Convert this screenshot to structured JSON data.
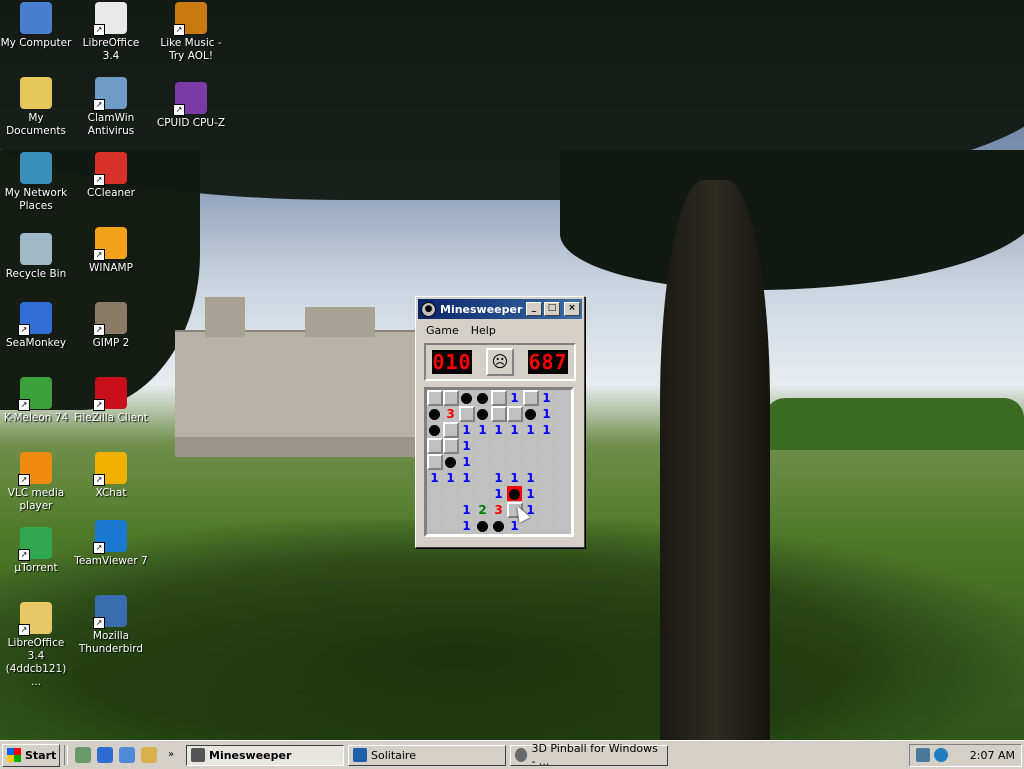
{
  "desktop_icons": [
    {
      "label": "My Computer",
      "icon": "computer-icon",
      "color": "#4a7fd0"
    },
    {
      "label": "My Documents",
      "icon": "documents-folder-icon",
      "color": "#e7c65a"
    },
    {
      "label": "My Network Places",
      "icon": "network-places-icon",
      "color": "#3a8fb8"
    },
    {
      "label": "Recycle Bin",
      "icon": "recycle-bin-icon",
      "color": "#9fb8c8"
    },
    {
      "label": "SeaMonkey",
      "icon": "seamonkey-icon",
      "color": "#2f6fd6"
    },
    {
      "label": "K-Meleon 74",
      "icon": "k-meleon-icon",
      "color": "#3aa13a"
    },
    {
      "label": "VLC media player",
      "icon": "vlc-icon",
      "color": "#f08a10"
    },
    {
      "label": "µTorrent",
      "icon": "utorrent-icon",
      "color": "#2fa84f"
    },
    {
      "label": "LibreOffice 3.4 (4ddcb121) ...",
      "icon": "folder-icon",
      "color": "#e8c864"
    },
    {
      "label": "LibreOffice 3.4",
      "icon": "libreoffice-icon",
      "color": "#e9e9e9"
    },
    {
      "label": "ClamWin Antivirus",
      "icon": "clamwin-icon",
      "color": "#6f9bc7"
    },
    {
      "label": "CCleaner",
      "icon": "ccleaner-icon",
      "color": "#d9302a"
    },
    {
      "label": "WINAMP",
      "icon": "winamp-icon",
      "color": "#f2a21a"
    },
    {
      "label": "GIMP 2",
      "icon": "gimp-icon",
      "color": "#8a7a66"
    },
    {
      "label": "FileZilla Client",
      "icon": "filezilla-icon",
      "color": "#c8101a"
    },
    {
      "label": "XChat",
      "icon": "xchat-icon",
      "color": "#f0b000"
    },
    {
      "label": "TeamViewer 7",
      "icon": "teamviewer-icon",
      "color": "#1b78d0"
    },
    {
      "label": "Mozilla Thunderbird",
      "icon": "thunderbird-icon",
      "color": "#3a6db0"
    },
    {
      "label": "Like Music - Try AOL!",
      "icon": "aol-music-icon",
      "color": "#c87a10"
    },
    {
      "label": "CPUID CPU-Z",
      "icon": "cpu-z-icon",
      "color": "#7a3aa8"
    }
  ],
  "minesweeper": {
    "title": "Minesweeper",
    "menu": [
      "Game",
      "Help"
    ],
    "mine_counter": "010",
    "timer": "687",
    "board": [
      [
        "h",
        "h",
        "m",
        "m",
        "h",
        "1",
        "h",
        "1",
        "e"
      ],
      [
        "m",
        "3",
        "h",
        "m",
        "h",
        "h",
        "m",
        "1",
        "e"
      ],
      [
        "m",
        "h",
        "1",
        "1",
        "1",
        "1",
        "1",
        "1",
        "e"
      ],
      [
        "h",
        "h",
        "1",
        "e",
        "e",
        "e",
        "e",
        "e",
        "e"
      ],
      [
        "h",
        "m",
        "1",
        "e",
        "e",
        "e",
        "e",
        "e",
        "e"
      ],
      [
        "1",
        "1",
        "1",
        "e",
        "1",
        "1",
        "1",
        "e",
        "e"
      ],
      [
        "e",
        "e",
        "e",
        "e",
        "1",
        "x",
        "1",
        "e",
        "e"
      ],
      [
        "e",
        "e",
        "1",
        "2",
        "3",
        "h",
        "1",
        "e",
        "e"
      ],
      [
        "e",
        "e",
        "1",
        "m",
        "m",
        "1",
        "e",
        "e",
        "e"
      ]
    ]
  },
  "taskbar": {
    "start_label": "Start",
    "quick_launch": [
      "show-desktop-icon",
      "firefox-icon",
      "email-icon",
      "explorer-icon"
    ],
    "tasks": [
      {
        "label": "Minesweeper",
        "active": true
      },
      {
        "label": "Solitaire",
        "active": false
      },
      {
        "label": "3D Pinball for Windows - ...",
        "active": false
      }
    ],
    "clock": "2:07 AM"
  }
}
